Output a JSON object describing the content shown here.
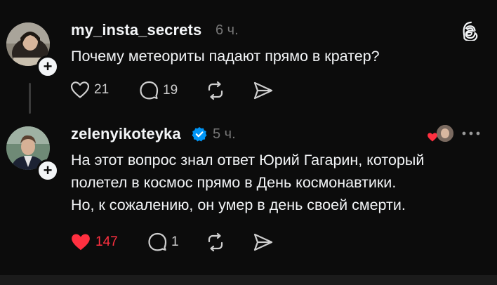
{
  "colors": {
    "background": "#0c0c0c",
    "text": "#f3f5f7",
    "muted": "#777777",
    "like_red": "#ff3040",
    "verified_blue": "#0095f6"
  },
  "posts": [
    {
      "username": "my_insta_secrets",
      "time": "6 ч.",
      "lines": [
        "Почему метеориты падают прямо в кратер?"
      ],
      "likes": "21",
      "replies": "19",
      "verified": false,
      "liked": false
    },
    {
      "username": "zelenyikoteyka",
      "time": "5 ч.",
      "lines": [
        "На этот вопрос знал ответ Юрий Гагарин, который",
        "полетел в космос прямо в День космонавтики.",
        "Но, к сожалению, он умер в день своей смерти."
      ],
      "likes": "147",
      "replies": "1",
      "verified": true,
      "liked": true
    }
  ],
  "icons": {
    "app_logo": "threads-logo-icon",
    "like": "heart-icon",
    "reply": "comment-icon",
    "repost": "repost-icon",
    "share": "send-icon",
    "more": "more-dots-icon",
    "follow": "plus-icon",
    "verified": "verified-badge-icon"
  },
  "follow_symbol": "+"
}
